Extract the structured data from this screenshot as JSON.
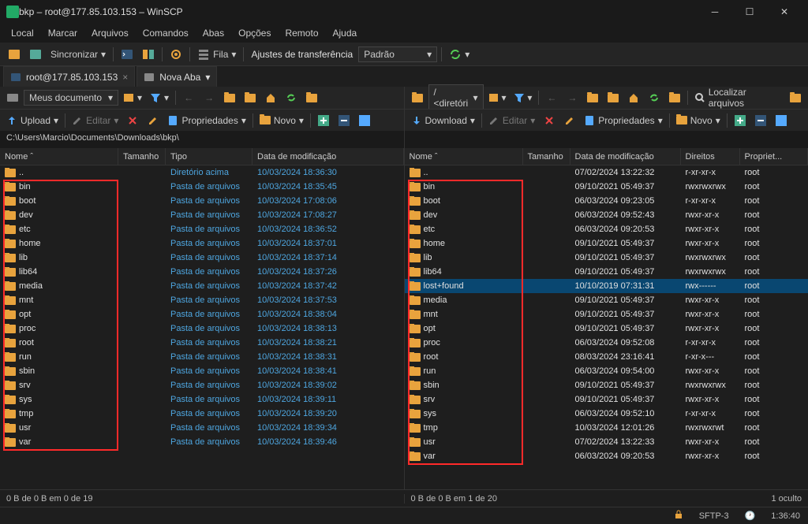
{
  "window": {
    "title": "bkp – root@177.85.103.153 – WinSCP"
  },
  "menu": [
    "Local",
    "Marcar",
    "Arquivos",
    "Comandos",
    "Abas",
    "Opções",
    "Remoto",
    "Ajuda"
  ],
  "maintoolbar": {
    "sync": "Sincronizar",
    "queue": "Fila",
    "transfer_label": "Ajustes de transferência",
    "transfer_value": "Padrão"
  },
  "tabs": {
    "session": "root@177.85.103.153",
    "newtab": "Nova Aba"
  },
  "leftloc": {
    "combo": "Meus documento"
  },
  "rightloc": {
    "combo": "/ <diretóri",
    "find": "Localizar arquivos"
  },
  "actions": {
    "upload": "Upload",
    "download": "Download",
    "edit": "Editar",
    "properties": "Propriedades",
    "new": "Novo"
  },
  "left": {
    "path": "C:\\Users\\Marcio\\Documents\\Downloads\\bkp\\",
    "cols": {
      "name": "Nome",
      "size": "Tamanho",
      "type": "Tipo",
      "modified": "Data de modificação"
    },
    "rows": [
      {
        "name": "..",
        "type": "Diretório acima",
        "mod": "10/03/2024 18:36:30",
        "parent": true
      },
      {
        "name": "bin",
        "type": "Pasta de arquivos",
        "mod": "10/03/2024 18:35:45"
      },
      {
        "name": "boot",
        "type": "Pasta de arquivos",
        "mod": "10/03/2024 17:08:06"
      },
      {
        "name": "dev",
        "type": "Pasta de arquivos",
        "mod": "10/03/2024 17:08:27"
      },
      {
        "name": "etc",
        "type": "Pasta de arquivos",
        "mod": "10/03/2024 18:36:52"
      },
      {
        "name": "home",
        "type": "Pasta de arquivos",
        "mod": "10/03/2024 18:37:01"
      },
      {
        "name": "lib",
        "type": "Pasta de arquivos",
        "mod": "10/03/2024 18:37:14"
      },
      {
        "name": "lib64",
        "type": "Pasta de arquivos",
        "mod": "10/03/2024 18:37:26"
      },
      {
        "name": "media",
        "type": "Pasta de arquivos",
        "mod": "10/03/2024 18:37:42"
      },
      {
        "name": "mnt",
        "type": "Pasta de arquivos",
        "mod": "10/03/2024 18:37:53"
      },
      {
        "name": "opt",
        "type": "Pasta de arquivos",
        "mod": "10/03/2024 18:38:04"
      },
      {
        "name": "proc",
        "type": "Pasta de arquivos",
        "mod": "10/03/2024 18:38:13"
      },
      {
        "name": "root",
        "type": "Pasta de arquivos",
        "mod": "10/03/2024 18:38:21"
      },
      {
        "name": "run",
        "type": "Pasta de arquivos",
        "mod": "10/03/2024 18:38:31"
      },
      {
        "name": "sbin",
        "type": "Pasta de arquivos",
        "mod": "10/03/2024 18:38:41"
      },
      {
        "name": "srv",
        "type": "Pasta de arquivos",
        "mod": "10/03/2024 18:39:02"
      },
      {
        "name": "sys",
        "type": "Pasta de arquivos",
        "mod": "10/03/2024 18:39:11"
      },
      {
        "name": "tmp",
        "type": "Pasta de arquivos",
        "mod": "10/03/2024 18:39:20"
      },
      {
        "name": "usr",
        "type": "Pasta de arquivos",
        "mod": "10/03/2024 18:39:34"
      },
      {
        "name": "var",
        "type": "Pasta de arquivos",
        "mod": "10/03/2024 18:39:46"
      }
    ],
    "status": "0 B de 0 B em 0 de 19"
  },
  "right": {
    "cols": {
      "name": "Nome",
      "size": "Tamanho",
      "modified": "Data de modificação",
      "rights": "Direitos",
      "owner": "Propriet..."
    },
    "rows": [
      {
        "name": "..",
        "mod": "07/02/2024 13:22:32",
        "rights": "r-xr-xr-x",
        "owner": "root",
        "parent": true
      },
      {
        "name": "bin",
        "mod": "09/10/2021 05:49:37",
        "rights": "rwxrwxrwx",
        "owner": "root"
      },
      {
        "name": "boot",
        "mod": "06/03/2024 09:23:05",
        "rights": "r-xr-xr-x",
        "owner": "root"
      },
      {
        "name": "dev",
        "mod": "06/03/2024 09:52:43",
        "rights": "rwxr-xr-x",
        "owner": "root"
      },
      {
        "name": "etc",
        "mod": "06/03/2024 09:20:53",
        "rights": "rwxr-xr-x",
        "owner": "root"
      },
      {
        "name": "home",
        "mod": "09/10/2021 05:49:37",
        "rights": "rwxr-xr-x",
        "owner": "root"
      },
      {
        "name": "lib",
        "mod": "09/10/2021 05:49:37",
        "rights": "rwxrwxrwx",
        "owner": "root"
      },
      {
        "name": "lib64",
        "mod": "09/10/2021 05:49:37",
        "rights": "rwxrwxrwx",
        "owner": "root"
      },
      {
        "name": "lost+found",
        "mod": "10/10/2019 07:31:31",
        "rights": "rwx------",
        "owner": "root",
        "selected": true
      },
      {
        "name": "media",
        "mod": "09/10/2021 05:49:37",
        "rights": "rwxr-xr-x",
        "owner": "root"
      },
      {
        "name": "mnt",
        "mod": "09/10/2021 05:49:37",
        "rights": "rwxr-xr-x",
        "owner": "root"
      },
      {
        "name": "opt",
        "mod": "09/10/2021 05:49:37",
        "rights": "rwxr-xr-x",
        "owner": "root"
      },
      {
        "name": "proc",
        "mod": "06/03/2024 09:52:08",
        "rights": "r-xr-xr-x",
        "owner": "root"
      },
      {
        "name": "root",
        "mod": "08/03/2024 23:16:41",
        "rights": "r-xr-x---",
        "owner": "root"
      },
      {
        "name": "run",
        "mod": "06/03/2024 09:54:00",
        "rights": "rwxr-xr-x",
        "owner": "root"
      },
      {
        "name": "sbin",
        "mod": "09/10/2021 05:49:37",
        "rights": "rwxrwxrwx",
        "owner": "root"
      },
      {
        "name": "srv",
        "mod": "09/10/2021 05:49:37",
        "rights": "rwxr-xr-x",
        "owner": "root"
      },
      {
        "name": "sys",
        "mod": "06/03/2024 09:52:10",
        "rights": "r-xr-xr-x",
        "owner": "root"
      },
      {
        "name": "tmp",
        "mod": "10/03/2024 12:01:26",
        "rights": "rwxrwxrwt",
        "owner": "root"
      },
      {
        "name": "usr",
        "mod": "07/02/2024 13:22:33",
        "rights": "rwxr-xr-x",
        "owner": "root"
      },
      {
        "name": "var",
        "mod": "06/03/2024 09:20:53",
        "rights": "rwxr-xr-x",
        "owner": "root"
      }
    ],
    "status": "0 B de 0 B em 1 de 20",
    "hidden": "1 oculto"
  },
  "bottombar": {
    "protocol": "SFTP-3",
    "time": "1:36:40"
  }
}
